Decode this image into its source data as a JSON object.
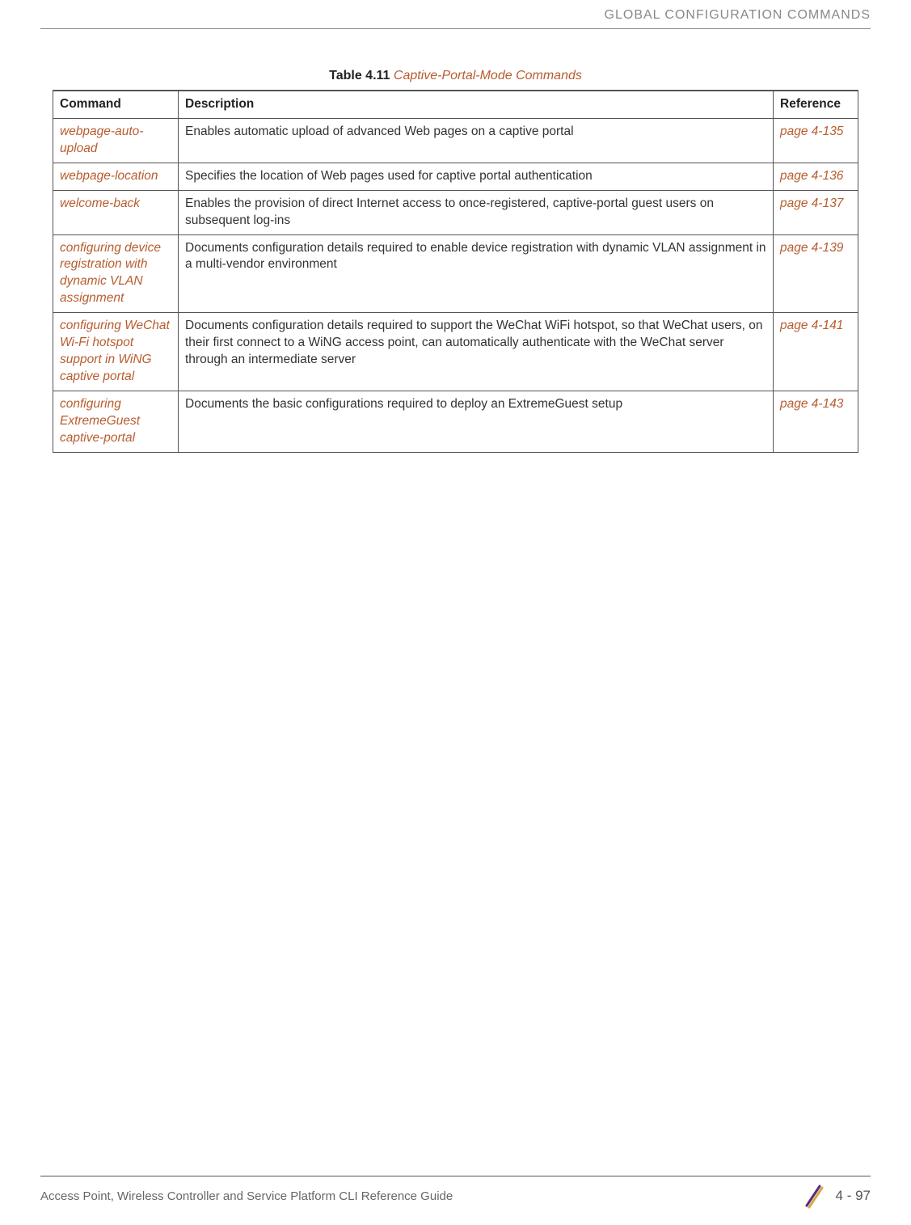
{
  "header": {
    "section_title": "GLOBAL CONFIGURATION COMMANDS"
  },
  "table": {
    "caption_label": "Table 4.11",
    "caption_title": "Captive-Portal-Mode Commands",
    "headers": {
      "command": "Command",
      "description": "Description",
      "reference": "Reference"
    },
    "rows": [
      {
        "command": "webpage-auto-upload",
        "description": "Enables automatic upload of advanced Web pages on a captive portal",
        "reference": "page 4-135"
      },
      {
        "command": "webpage-location",
        "description": "Specifies the location of Web pages used for captive portal authentication",
        "reference": "page 4-136"
      },
      {
        "command": "welcome-back",
        "description": "Enables the provision of direct Internet access to once-registered, captive-portal guest users on subsequent log-ins",
        "reference": "page 4-137"
      },
      {
        "command": "configuring device registration with dynamic VLAN assignment",
        "description": "Documents configuration details required to enable device registration with dynamic VLAN assignment in a multi-vendor environment",
        "reference": "page 4-139"
      },
      {
        "command": "configuring WeChat Wi-Fi hotspot support in WiNG captive portal",
        "description": "Documents configuration details required to support the WeChat WiFi hotspot, so that WeChat users, on their first connect to a WiNG access point, can automatically authenticate with the WeChat server through an intermediate server",
        "reference": "page 4-141"
      },
      {
        "command": "configuring ExtremeGuest captive-portal",
        "description": "Documents the basic configurations required to deploy an ExtremeGuest setup",
        "reference": "page 4-143"
      }
    ]
  },
  "footer": {
    "guide_title": "Access Point, Wireless Controller and Service Platform CLI Reference Guide",
    "page_number": "4 - 97"
  }
}
